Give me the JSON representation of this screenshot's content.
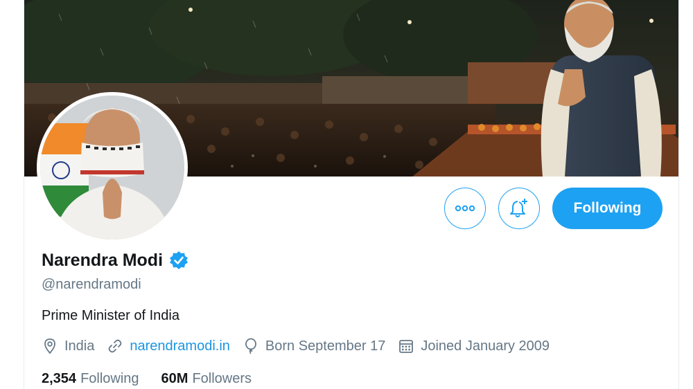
{
  "profile": {
    "display_name": "Narendra Modi",
    "handle": "@narendramodi",
    "bio": "Prime Minister of India",
    "location": "India",
    "website": "narendramodi.in",
    "birthday": "Born September 17",
    "joined": "Joined January 2009"
  },
  "actions": {
    "follow_state_label": "Following"
  },
  "stats": {
    "following_count": "2,354",
    "following_label": "Following",
    "followers_count": "60M",
    "followers_label": "Followers"
  },
  "icons": {
    "more": "more-options-icon",
    "notify": "notification-bell-add-icon",
    "verified": "verified-badge-icon",
    "location": "location-pin-icon",
    "link": "link-icon",
    "birthday": "balloon-icon",
    "calendar": "calendar-icon"
  },
  "colors": {
    "accent": "#1da1f2",
    "link": "#1b95e0",
    "secondary_text": "#657786",
    "primary_text": "#14171a"
  }
}
